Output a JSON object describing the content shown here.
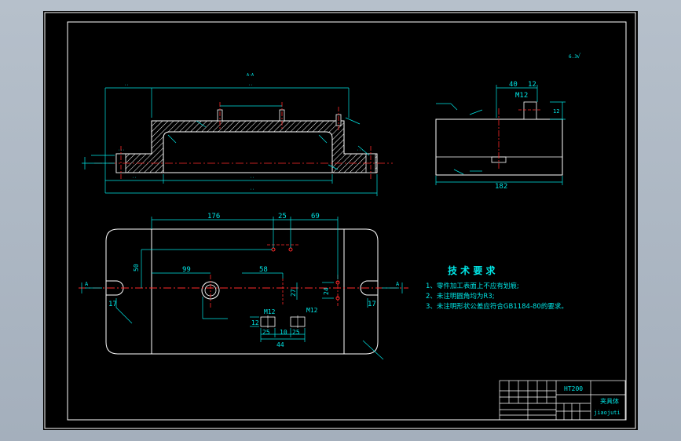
{
  "section": {
    "label": "A-A"
  },
  "dims": {
    "top_176": "176",
    "top_25": "25",
    "top_69": "69",
    "d99": "99",
    "d58": "58",
    "d50": "50",
    "d27": "27",
    "d17_left": "17",
    "d17_right": "17",
    "d24": "24",
    "m12_a": "M12",
    "m12_b": "M12",
    "d12": "12",
    "d25_a": "25",
    "d10": "10",
    "d25_b": "25",
    "d44": "44",
    "cut_a_left": "A",
    "cut_a_right": "A",
    "side_40": "40",
    "side_12": "12",
    "side_m12": "M12",
    "side_182": "182",
    "side_12b": "12"
  },
  "roughness": {
    "corner": "√",
    "value": "6.3"
  },
  "tech": {
    "title": "技 术 要 求",
    "items": [
      "1、零件加工表面上不应有划痕;",
      "2、未注明圆角均为R3;",
      "3、未注明形状公差应符合GB1184-80的要求。"
    ]
  },
  "title_block": {
    "material": "HT200",
    "part_name": "夹具体",
    "drawing_id": "jiaojuti"
  },
  "colors": {
    "background": "#000000",
    "outline": "#ffffff",
    "dimension": "#00e5e5",
    "centerline": "#ff2a2a",
    "hatch": "#ffffff",
    "annotation_green": "#00ff55",
    "text_yellow": "#ffff00"
  }
}
